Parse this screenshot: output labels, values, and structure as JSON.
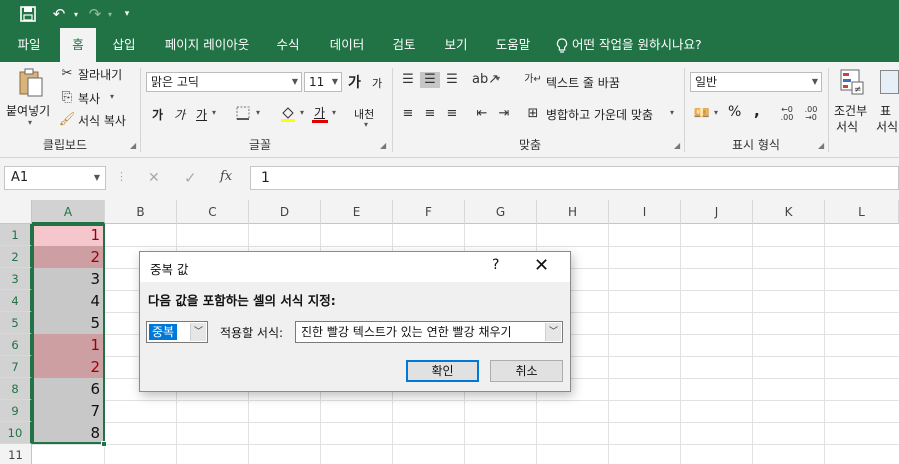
{
  "qat": {
    "save_icon": "save-icon",
    "undo_icon": "undo-icon",
    "redo_icon": "redo-icon",
    "customize_icon": "customize-qat-icon"
  },
  "tabs": [
    {
      "label": "파일"
    },
    {
      "label": "홈"
    },
    {
      "label": "삽입"
    },
    {
      "label": "페이지 레이아웃"
    },
    {
      "label": "수식"
    },
    {
      "label": "데이터"
    },
    {
      "label": "검토"
    },
    {
      "label": "보기"
    },
    {
      "label": "도움말"
    },
    {
      "label": "어떤 작업을 원하시나요?"
    }
  ],
  "ribbon": {
    "clipboard": {
      "paste": "붙여넣기",
      "cut": "잘라내기",
      "copy": "복사",
      "format_painter": "서식 복사",
      "label": "클립보드"
    },
    "font": {
      "name": "맑은 고딕",
      "size": "11",
      "grow": "가",
      "shrink": "가",
      "bold": "가",
      "italic": "가",
      "underline": "가",
      "font_color": "가",
      "phonetic": "내천",
      "label": "글꼴"
    },
    "alignment": {
      "wrap": "텍스트 줄 바꿈",
      "merge": "병합하고 가운데 맞춤",
      "label": "맞춤"
    },
    "number": {
      "format": "일반",
      "percent": "%",
      "comma": ",",
      "label": "표시 형식"
    },
    "styles": {
      "conditional": "조건부",
      "conditional2": "서식",
      "table": "표",
      "table2": "서식"
    }
  },
  "formula_bar": {
    "name_box": "A1",
    "cancel": "✕",
    "enter": "✓",
    "fx": "fx",
    "value": "1"
  },
  "columns": [
    "A",
    "B",
    "C",
    "D",
    "E",
    "F",
    "G",
    "H",
    "I",
    "J",
    "K",
    "L"
  ],
  "rows": [
    "1",
    "2",
    "3",
    "4",
    "5",
    "6",
    "7",
    "8",
    "9",
    "10",
    "11"
  ],
  "cells_a": [
    "1",
    "2",
    "3",
    "4",
    "5",
    "1",
    "2",
    "6",
    "7",
    "8"
  ],
  "dialog": {
    "title": "중복 값",
    "help": "?",
    "close": "✕",
    "prompt": "다음 값을 포함하는 셀의 서식 지정:",
    "type_value": "중복",
    "with_label": "적용할 서식:",
    "format_value": "진한 빨강 텍스트가 있는 연한 빨강 채우기",
    "ok": "확인",
    "cancel": "취소"
  }
}
